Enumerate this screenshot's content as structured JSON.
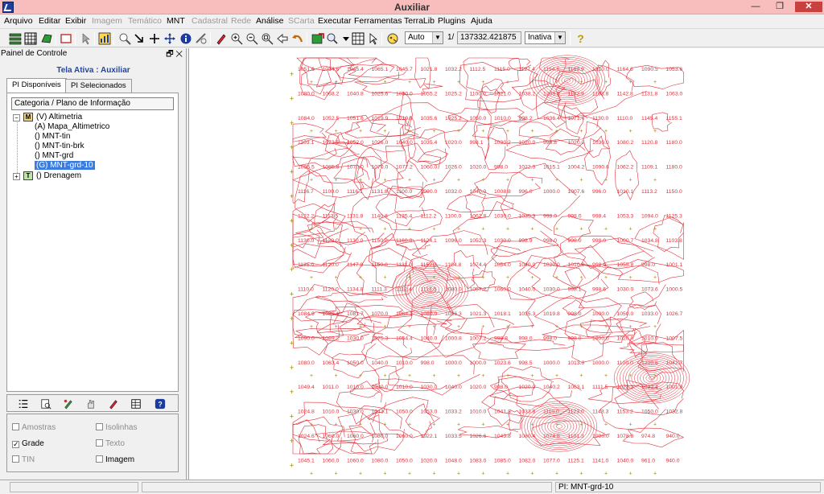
{
  "window": {
    "title": "Auxiliar",
    "minimize": "—",
    "restore": "❐",
    "close": "✕"
  },
  "menu": [
    {
      "label": "Arquivo",
      "enabled": true
    },
    {
      "label": "Editar",
      "enabled": true
    },
    {
      "label": "Exibir",
      "enabled": true
    },
    {
      "label": "Imagem",
      "enabled": false
    },
    {
      "label": "Temático",
      "enabled": false
    },
    {
      "label": "MNT",
      "enabled": true
    },
    {
      "label": "Cadastral",
      "enabled": false
    },
    {
      "label": "Rede",
      "enabled": false
    },
    {
      "label": "Análise",
      "enabled": true
    },
    {
      "label": "SCarta",
      "enabled": false
    },
    {
      "label": "Executar",
      "enabled": true
    },
    {
      "label": "Ferramentas",
      "enabled": true
    },
    {
      "label": "TerraLib",
      "enabled": true
    },
    {
      "label": "Plugins",
      "enabled": true
    },
    {
      "label": "Ajuda",
      "enabled": true
    }
  ],
  "toolbar": {
    "scale_mode": "Auto",
    "scale_prefix": "1/",
    "scale_value": "137332.421875",
    "status_select": "Inativa"
  },
  "panel": {
    "title": "Painel de Controle",
    "panel_buttons": "🗗 ✕",
    "active_screen": "Tela Ativa : Auxiliar",
    "tabs": [
      "PI Disponíveis",
      "PI Selecionados"
    ],
    "tree_header": "Categoria / Plano de Informação",
    "category_altimetria": "(V) Altimetria",
    "category_drenagem": "() Drenagem",
    "items": [
      {
        "label": "(A) Mapa_Altimetrico",
        "selected": false
      },
      {
        "label": "() MNT-tin",
        "selected": false
      },
      {
        "label": "() MNT-tin-brk",
        "selected": false
      },
      {
        "label": "() MNT-grd",
        "selected": false
      },
      {
        "label": "(G) MNT-grd-10",
        "selected": true
      }
    ],
    "icon_m": "M",
    "icon_t": "T",
    "expander_minus": "−",
    "expander_plus": "+",
    "checks": {
      "amostras": {
        "label": "Amostras",
        "checked": false,
        "enabled": false
      },
      "isolinhas": {
        "label": "Isolinhas",
        "checked": false,
        "enabled": false
      },
      "grade": {
        "label": "Grade",
        "checked": true,
        "enabled": true
      },
      "texto": {
        "label": "Texto",
        "checked": false,
        "enabled": false
      },
      "tin": {
        "label": "TIN",
        "checked": false,
        "enabled": false
      },
      "imagem": {
        "label": "Imagem",
        "checked": false,
        "enabled": true
      }
    },
    "check_mark": "✓"
  },
  "map": {
    "contour_color": "#e0303a",
    "grid_marker_color": "#9a8a00",
    "grid_values": [
      [
        "1051.6",
        "1034.6",
        "1045.4",
        "1065.1",
        "1045.7",
        "1021.8",
        "1032.2",
        "1112.5",
        "1115.0",
        "1127.4",
        "1154.6",
        "1169.9",
        "1210.0",
        "1164.6",
        "1090.5",
        "1053.6"
      ],
      [
        "1080.0",
        "1068.2",
        "1040.8",
        "1025.6",
        "1050.0",
        "1055.2",
        "1025.2",
        "1100.0",
        "1021.0",
        "1038.2",
        "1209.8",
        "1132.9",
        "1163.8",
        "1142.8",
        "1131.8",
        "1063.0"
      ],
      [
        "1084.0",
        "1052.5",
        "1051.6",
        "1019.9",
        "1010.0",
        "1035.6",
        "1025.2",
        "1050.0",
        "1010.0",
        "998.2",
        "1036.4",
        "1071.4",
        "1130.0",
        "1110.0",
        "1145.4",
        "1155.1"
      ],
      [
        "1103.1",
        "1073.5",
        "1052.0",
        "1026.0",
        "1040.0",
        "1035.4",
        "1020.0",
        "998.1",
        "1030.2",
        "1020.0",
        "998.8",
        "1020.0",
        "1030.0",
        "1080.2",
        "1120.8",
        "1180.0"
      ],
      [
        "1095.5",
        "1085.8",
        "1070.0",
        "1070.0",
        "1077.2",
        "1060.0",
        "1026.0",
        "1020.0",
        "998.0",
        "1022.0",
        "1015.1",
        "1004.2",
        "1090.6",
        "1062.2",
        "1109.1",
        "1180.0"
      ],
      [
        "1116.7",
        "1100.0",
        "1116.1",
        "1131.8",
        "1100.0",
        "1090.0",
        "1032.0",
        "1040.0",
        "1008.8",
        "996.0",
        "1000.0",
        "1007.6",
        "996.0",
        "1010.1",
        "1113.2",
        "1150.0"
      ],
      [
        "1122.2",
        "1113.5",
        "1131.8",
        "1140.8",
        "1135.4",
        "1112.2",
        "1100.0",
        "1062.8",
        "1030.0",
        "1035.3",
        "998.0",
        "998.0",
        "998.4",
        "1053.3",
        "1094.0",
        "1125.3"
      ],
      [
        "1130.0",
        "1120.0",
        "1130.0",
        "1150.0",
        "1160.0",
        "1124.1",
        "1096.0",
        "1052.3",
        "1030.0",
        "998.9",
        "998.0",
        "998.0",
        "998.0",
        "1000.7",
        "1034.8",
        "1103.8"
      ],
      [
        "1125.0",
        "1120.0",
        "1147.0",
        "1150.0",
        "1131.0",
        "1152.3",
        "1104.8",
        "1074.4",
        "1054.0",
        "1040.0",
        "1020.0",
        "1010.0",
        "998.0",
        "1055.8",
        "998.0",
        "1001.1"
      ],
      [
        "1110.0",
        "1120.0",
        "1134.8",
        "1111.3",
        "1112.4",
        "1114.5",
        "1080.0",
        "1057.2",
        "1060.0",
        "1040.0",
        "1030.0",
        "998.1",
        "998.6",
        "1030.0",
        "1073.6",
        "1000.5"
      ],
      [
        "1084.9",
        "1089.1",
        "1081.7",
        "1070.0",
        "1064.1",
        "1080.0",
        "1056.3",
        "1021.3",
        "1018.1",
        "1035.3",
        "1019.8",
        "998.0",
        "1000.0",
        "1050.0",
        "1033.0",
        "1026.7"
      ],
      [
        "1090.0",
        "1089.2",
        "1030.0",
        "1075.3",
        "1054.4",
        "1040.0",
        "1000.8",
        "1007.2",
        "998.8",
        "998.0",
        "998.0",
        "998.0",
        "1000.0",
        "1020.0",
        "1010.0",
        "1007.5"
      ],
      [
        "1080.0",
        "1063.4",
        "1050.0",
        "1040.0",
        "1010.0",
        "998.0",
        "1000.0",
        "1000.0",
        "1023.6",
        "998.5",
        "1000.0",
        "1013.0",
        "1000.0",
        "1100.0",
        "1200.6",
        "1042.7"
      ],
      [
        "1049.4",
        "1011.0",
        "1010.0",
        "1020.0",
        "1010.0",
        "1030.0",
        "1040.0",
        "1020.0",
        "998.0",
        "1020.0",
        "1040.2",
        "1063.1",
        "1111.5",
        "1073.2",
        "1032.4",
        "1001.9"
      ],
      [
        "1024.8",
        "1010.0",
        "1030.0",
        "1043.1",
        "1050.0",
        "1053.0",
        "1033.2",
        "1010.0",
        "1041.8",
        "1033.8",
        "1110.0",
        "1123.0",
        "1143.3",
        "1153.2",
        "1050.0",
        "1032.8"
      ],
      [
        "1024.6",
        "1060.0",
        "1060.0",
        "1080.0",
        "1060.0",
        "1022.1",
        "1033.5",
        "1026.6",
        "1043.8",
        "1080.4",
        "1074.8",
        "1101.3",
        "1090.0",
        "1078.8",
        "974.8",
        "940.0"
      ],
      [
        "1045.1",
        "1060.0",
        "1060.0",
        "1080.0",
        "1050.0",
        "1020.0",
        "1048.0",
        "1083.0",
        "1085.0",
        "1082.0",
        "1077.0",
        "1125.1",
        "1141.0",
        "1040.0",
        "961.0",
        "940.0"
      ]
    ]
  },
  "status": {
    "left": "",
    "middle": "",
    "right": "PI: MNT-grd-10"
  }
}
